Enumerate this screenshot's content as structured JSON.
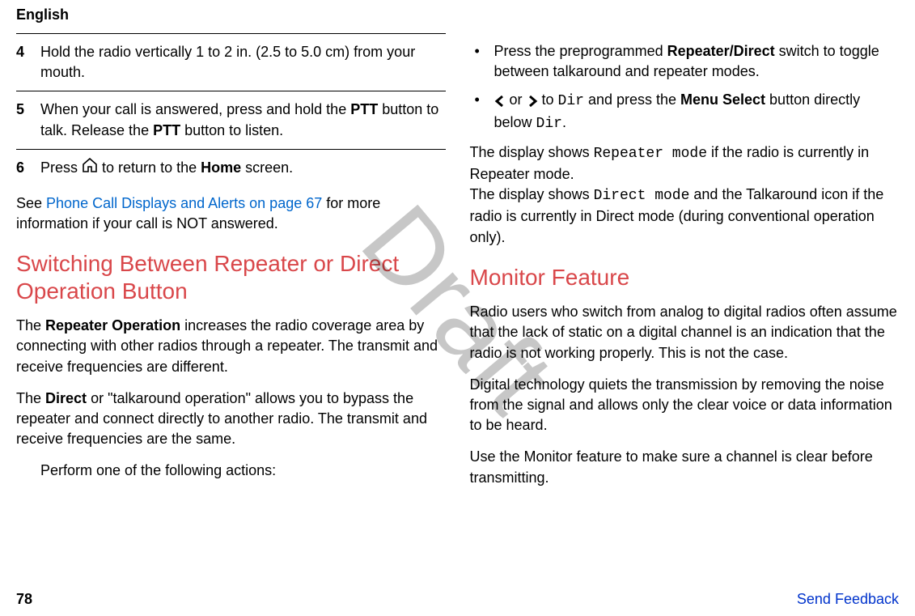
{
  "header": {
    "language": "English"
  },
  "left": {
    "steps": {
      "s4": {
        "num": "4",
        "text_a": "Hold the radio vertically 1 to 2 in. (2.5 to 5.0 cm) from your mouth."
      },
      "s5": {
        "num": "5",
        "text_a": "When your call is answered, press and hold the ",
        "bold1": "PTT",
        "text_b": " button to talk. Release the ",
        "bold2": "PTT",
        "text_c": " button to listen."
      },
      "s6": {
        "num": "6",
        "text_a": "Press ",
        "text_b": " to return to the ",
        "bold1": "Home",
        "text_c": " screen."
      }
    },
    "see_a": "See ",
    "see_link": "Phone Call Displays and Alerts on page 67",
    "see_b": " for more information if your call is NOT answered.",
    "heading1": "Switching Between Repeater or Direct Operation Button",
    "para1_a": "The ",
    "para1_bold": "Repeater Operation",
    "para1_b": " increases the radio coverage area by connecting with other radios through a repeater. The transmit and receive frequencies are different.",
    "para2_a": "The ",
    "para2_bold": "Direct",
    "para2_b": " or \"talkaround operation\" allows you to bypass the repeater and connect directly to another radio. The transmit and receive frequencies are the same.",
    "perform": "Perform one of the following actions:"
  },
  "right": {
    "bullet1_a": "Press the preprogrammed ",
    "bullet1_bold": "Repeater/Direct",
    "bullet1_b": " switch to toggle between talkaround and repeater modes.",
    "bullet2_a": " or ",
    "bullet2_b": " to ",
    "bullet2_mono1": "Dir",
    "bullet2_c": " and press the ",
    "bullet2_bold": "Menu Select",
    "bullet2_d": " button directly below ",
    "bullet2_mono2": "Dir",
    "bullet2_e": ".",
    "disp1_a": "The display shows ",
    "disp1_mono": "Repeater mode",
    "disp1_b": " if the radio is currently in Repeater mode.",
    "disp2_a": "The display shows ",
    "disp2_mono": "Direct mode",
    "disp2_b": " and the Talkaround icon if the radio is currently in Direct mode (during conventional operation only).",
    "heading2": "Monitor Feature",
    "mf_p1": "Radio users who switch from analog to digital radios often assume that the lack of static on a digital channel is an indication that the radio is not working properly. This is not the case.",
    "mf_p2": "Digital technology quiets the transmission by removing the noise from the signal and allows only the clear voice or data information to be heard.",
    "mf_p3": "Use the Monitor feature to make sure a channel is clear before transmitting."
  },
  "footer": {
    "page": "78",
    "feedback": "Send Feedback"
  },
  "watermark": "Draft"
}
